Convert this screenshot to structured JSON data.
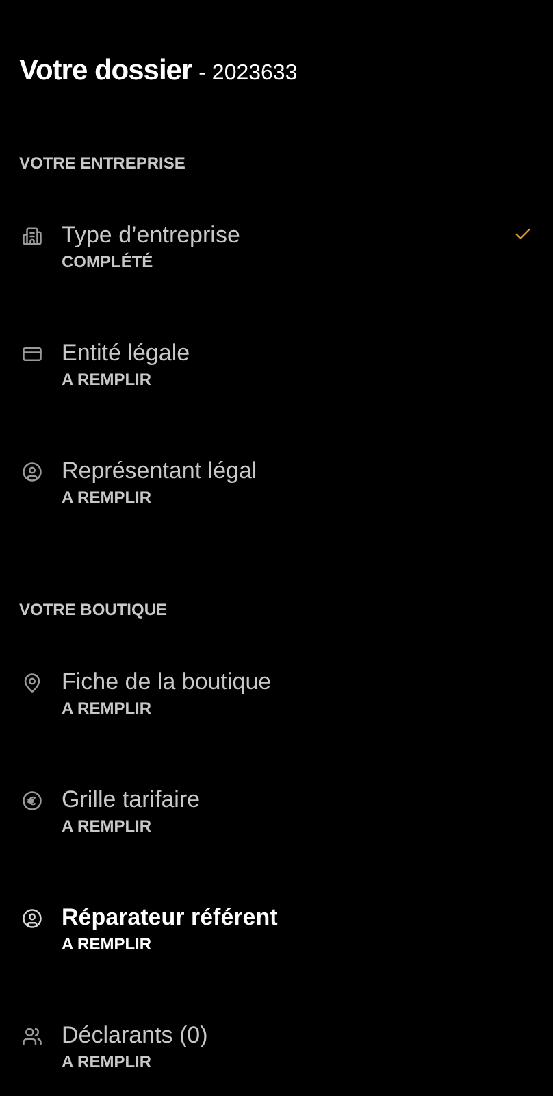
{
  "header": {
    "title": "Votre dossier",
    "number": "- 2023633"
  },
  "sections": [
    {
      "heading": "VOTRE ENTREPRISE",
      "items": [
        {
          "kind": "building",
          "label": "Type d’entreprise",
          "status": "COMPLÉTÉ",
          "completed": true,
          "selected": false
        },
        {
          "kind": "card",
          "label": "Entité légale",
          "status": "A REMPLIR",
          "completed": false,
          "selected": false
        },
        {
          "kind": "person",
          "label": "Représentant légal",
          "status": "A REMPLIR",
          "completed": false,
          "selected": false
        }
      ]
    },
    {
      "heading": "VOTRE BOUTIQUE",
      "items": [
        {
          "kind": "pin",
          "label": "Fiche de la boutique",
          "status": "A REMPLIR",
          "completed": false,
          "selected": false
        },
        {
          "kind": "euro",
          "label": "Grille tarifaire",
          "status": "A REMPLIR",
          "completed": false,
          "selected": false
        },
        {
          "kind": "person",
          "label": "Réparateur référent",
          "status": "A REMPLIR",
          "completed": false,
          "selected": true
        },
        {
          "kind": "people",
          "label": "Déclarants (0)",
          "status": "A REMPLIR",
          "completed": false,
          "selected": false
        }
      ]
    }
  ]
}
